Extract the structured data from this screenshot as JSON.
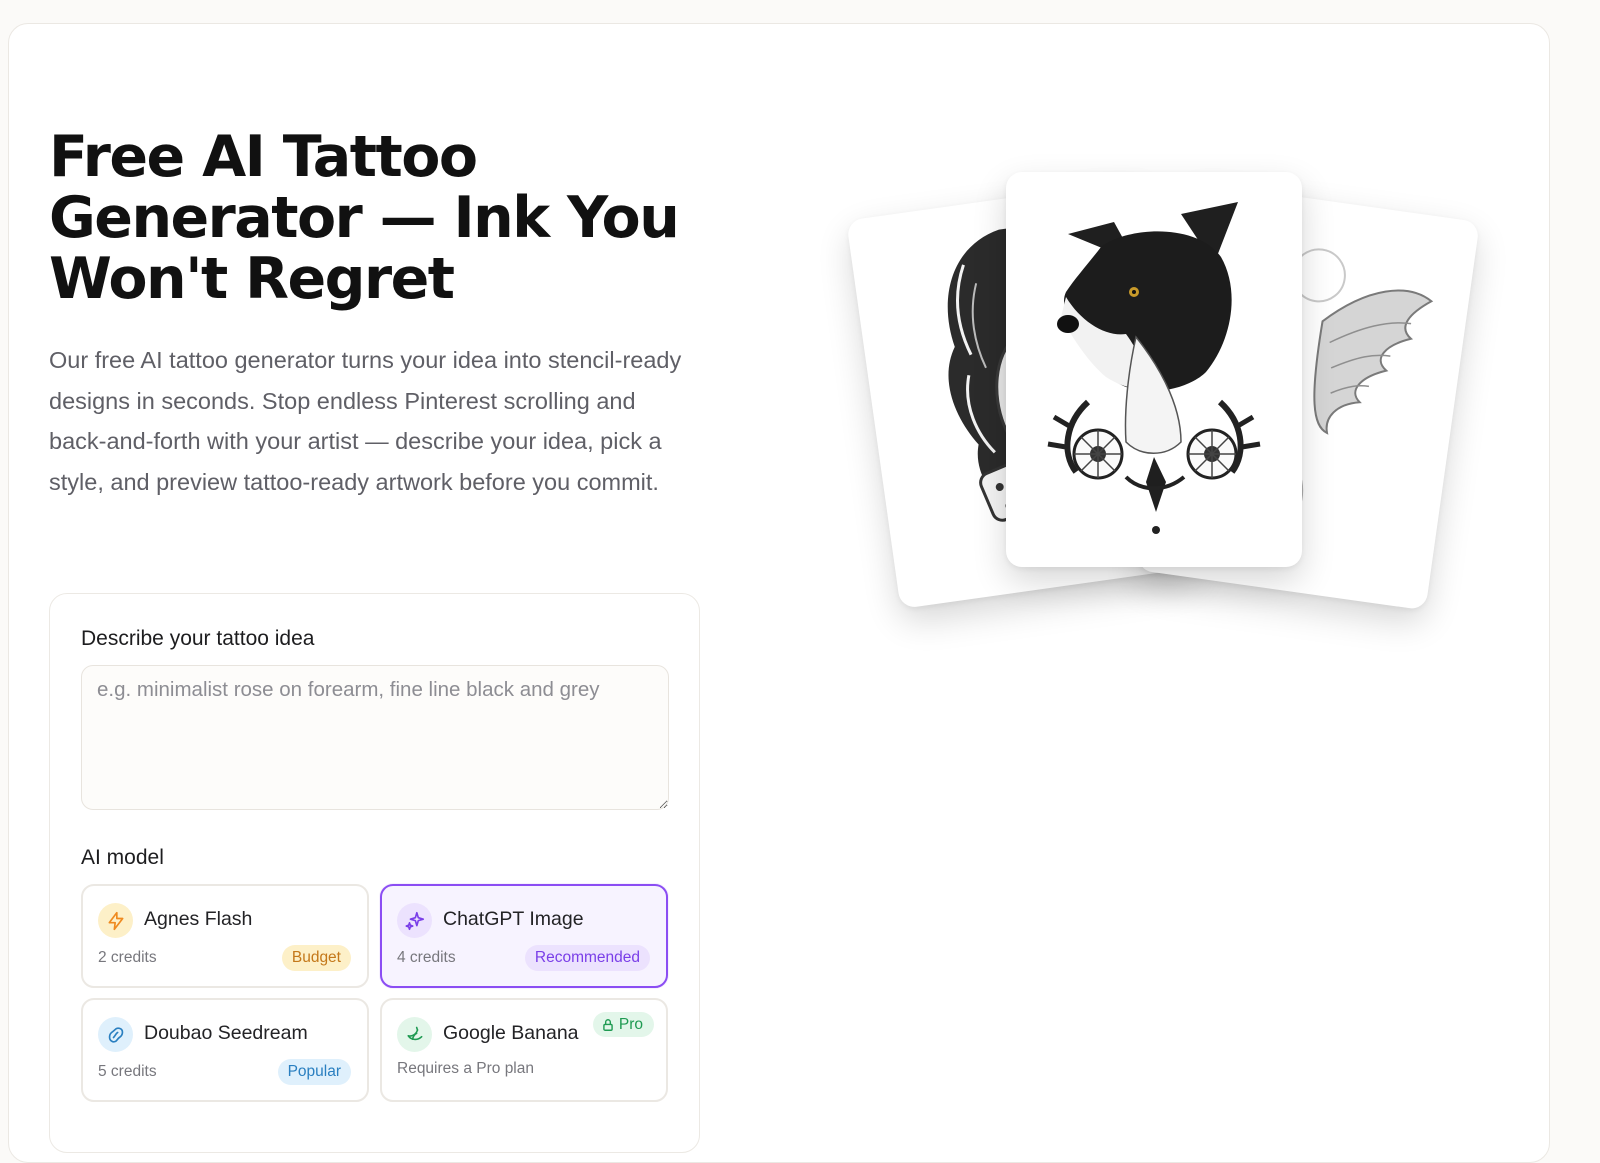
{
  "hero": {
    "title": "Free AI Tattoo Generator — Ink You Won't Regret",
    "description": "Our free AI tattoo generator turns your idea into stencil-ready designs in seconds. Stop endless Pinterest scrolling and back-and-forth with your artist — describe your idea, pick a style, and preview tattoo-ready artwork before you commit."
  },
  "form": {
    "idea_label": "Describe your tattoo idea",
    "idea_placeholder": "e.g. minimalist rose on forearm, fine line black and grey",
    "idea_value": "",
    "model_label": "AI model",
    "models": [
      {
        "name": "Agnes Flash",
        "credits": "2 credits",
        "badge": "Budget",
        "icon": "lightning-icon",
        "selected": false
      },
      {
        "name": "ChatGPT Image",
        "credits": "4 credits",
        "badge": "Recommended",
        "icon": "sparkles-icon",
        "selected": true
      },
      {
        "name": "Doubao Seedream",
        "credits": "5 credits",
        "badge": "Popular",
        "icon": "bean-icon",
        "selected": false
      },
      {
        "name": "Google Banana",
        "credits": "Requires a Pro plan",
        "badge": "Pro",
        "icon": "banana-icon",
        "selected": false,
        "locked": true
      }
    ]
  },
  "gallery": {
    "cards": [
      {
        "subject": "woman-portrait-tattoo"
      },
      {
        "subject": "angel-wing-tattoo"
      },
      {
        "subject": "dog-portrait-tattoo"
      }
    ]
  },
  "colors": {
    "accent": "#8b4df3",
    "budget_bg": "#fdf0c8",
    "budget_text": "#c4781a",
    "recommended_bg": "#ece2fe",
    "recommended_text": "#7a3ee8",
    "popular_bg": "#dff0fc",
    "popular_text": "#2a7fc0",
    "pro_bg": "#e3f6ea",
    "pro_text": "#1f9a52"
  }
}
